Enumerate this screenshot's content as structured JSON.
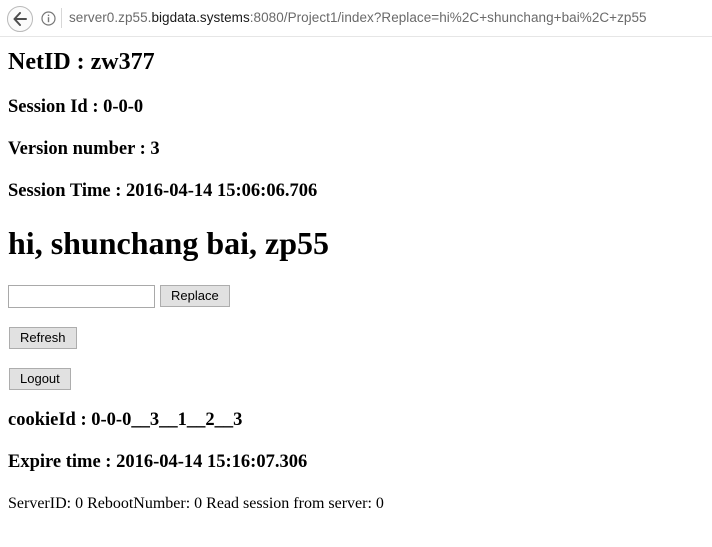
{
  "browser": {
    "url_prefix": "server0.zp55.",
    "url_domain": "bigdata.systems",
    "url_suffix": ":8080/Project1/index?Replace=hi%2C+shunchang+bai%2C+zp55"
  },
  "page": {
    "netid": "NetID : zw377",
    "session_id": "Session Id : 0-0-0",
    "version": "Version number : 3",
    "session_time": "Session Time : 2016-04-14 15:06:06.706",
    "message": "hi, shunchang bai, zp55",
    "replace_input_value": "",
    "replace_label": "Replace",
    "refresh_label": "Refresh",
    "logout_label": "Logout",
    "cookie_id": "cookieId : 0-0-0__3__1__2__3",
    "expire_time": "Expire time : 2016-04-14 15:16:07.306",
    "server_info": "ServerID: 0 RebootNumber: 0 Read session from server: 0"
  }
}
